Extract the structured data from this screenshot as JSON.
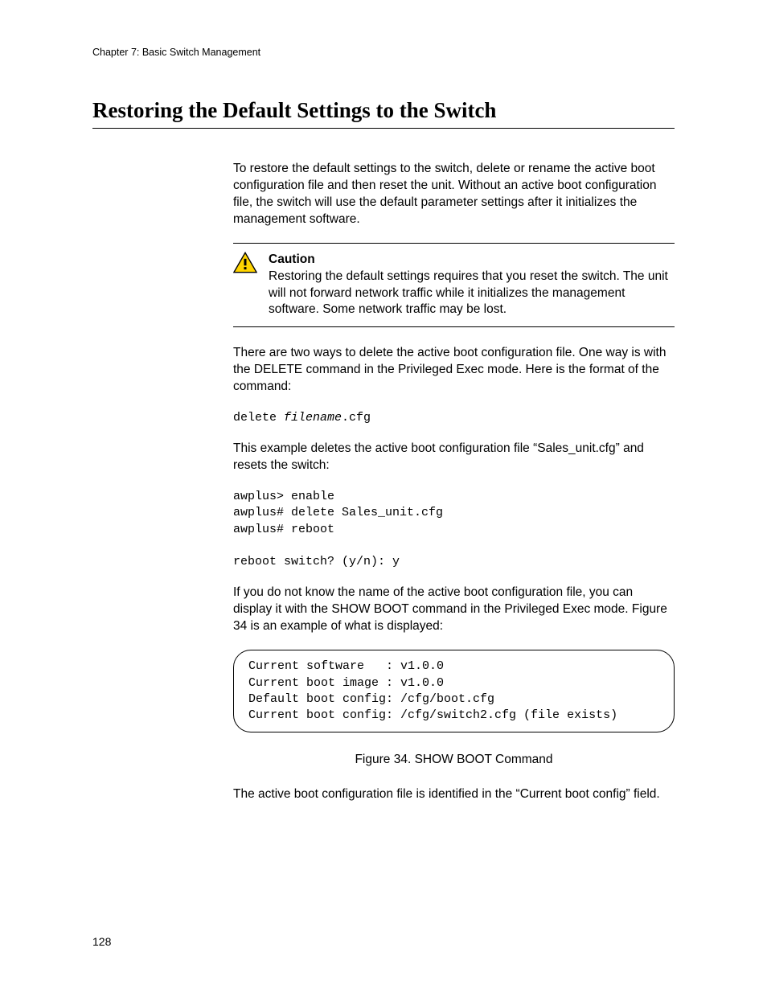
{
  "running_head": "Chapter 7: Basic Switch Management",
  "section_title": "Restoring the Default Settings to the Switch",
  "para1": "To restore the default settings to the switch, delete or rename the active boot configuration file and then reset the unit. Without an active boot configuration file, the switch will use the default parameter settings after it initializes the management software.",
  "caution": {
    "label": "Caution",
    "text": "Restoring the default settings requires that you reset the switch. The unit will not forward network traffic while it initializes the management software. Some network traffic may be lost."
  },
  "para2": "There are two ways to delete the active boot configuration file. One way is with the DELETE command in the Privileged Exec mode. Here is the format of the command:",
  "cmd_format_pre": "delete ",
  "cmd_format_italic": "filename",
  "cmd_format_post": ".cfg",
  "para3": "This example deletes the active boot configuration file “Sales_unit.cfg” and resets the switch:",
  "example_block": "awplus> enable\nawplus# delete Sales_unit.cfg\nawplus# reboot\n\nreboot switch? (y/n): y",
  "para4": "If you do not know the name of the active boot configuration file, you can display it with the SHOW BOOT command in the Privileged Exec mode. Figure 34 is an example of what is displayed:",
  "figure_block": "Current software   : v1.0.0\nCurrent boot image : v1.0.0\nDefault boot config: /cfg/boot.cfg\nCurrent boot config: /cfg/switch2.cfg (file exists)",
  "figure_caption": "Figure 34. SHOW BOOT Command",
  "para5": "The active boot configuration file is identified in the “Current boot config” field.",
  "page_number": "128"
}
